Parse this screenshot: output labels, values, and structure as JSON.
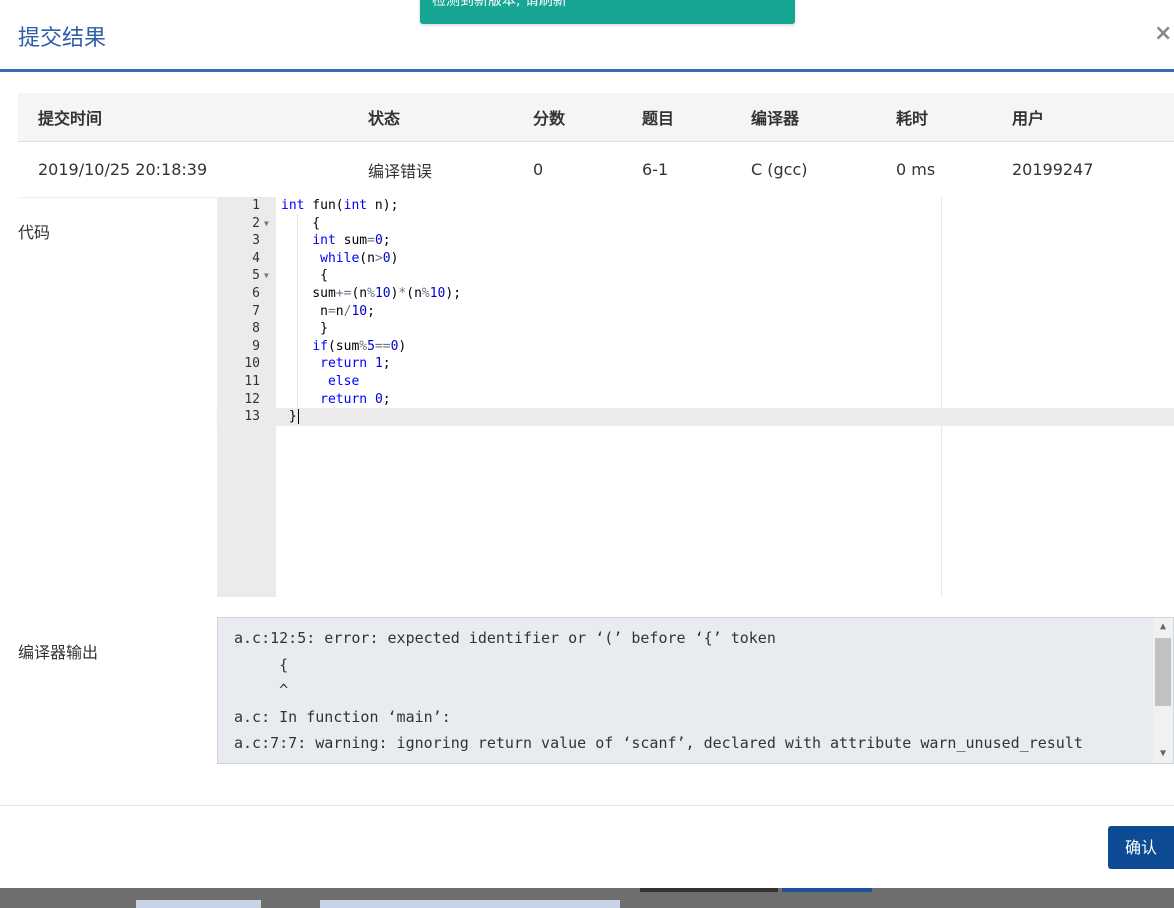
{
  "toast": {
    "text": "检测到新版本, 请刷新"
  },
  "dialog": {
    "title": "提交结果",
    "close_label": "×",
    "confirm_label": "确认"
  },
  "table": {
    "headers": [
      "提交时间",
      "状态",
      "分数",
      "题目",
      "编译器",
      "耗时",
      "用户"
    ],
    "row": {
      "time": "2019/10/25 20:18:39",
      "status": "编译错误",
      "score": "0",
      "problem": "6-1",
      "compiler": "C (gcc)",
      "duration": "0 ms",
      "user": "20199247"
    }
  },
  "labels": {
    "code": "代码",
    "compiler_output": "编译器输出"
  },
  "code_lines": [
    "int fun(int n);",
    "    {",
    "    int sum=0;",
    "     while(n>0)",
    "     {",
    "    sum+=(n%10)*(n%10);",
    "     n=n/10;",
    "     }",
    "    if(sum%5==0)",
    "     return 1;",
    "      else",
    "     return 0;",
    " }"
  ],
  "compiler_output": [
    "a.c:12:5: error: expected identifier or ‘(’ before ‘{’ token",
    "     {",
    "     ^",
    "a.c: In function ‘main’:",
    "a.c:7:7: warning: ignoring return value of ‘scanf’, declared with attribute warn_unused_result"
  ]
}
